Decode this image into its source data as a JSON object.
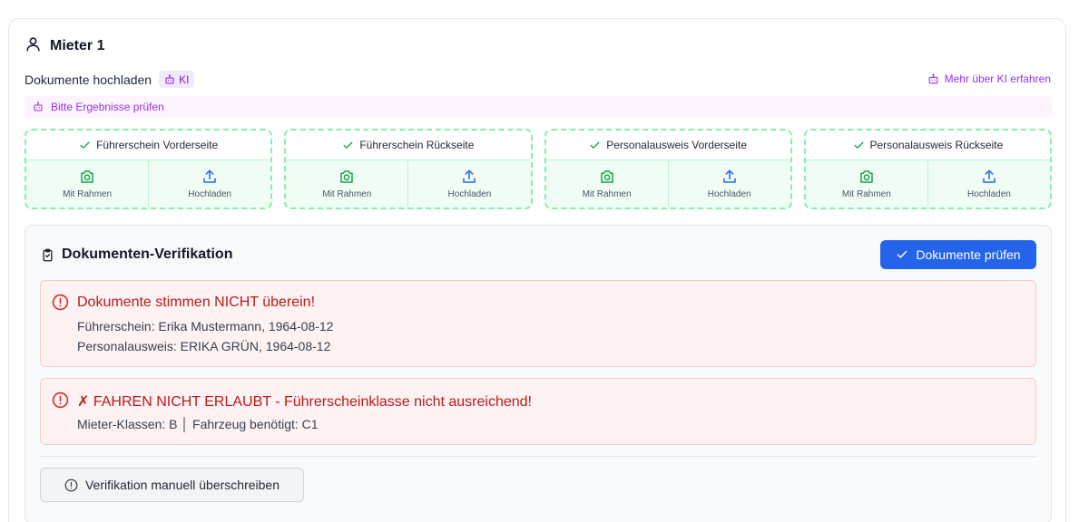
{
  "tenant": {
    "title": "Mieter 1",
    "icon": "user-icon"
  },
  "upload": {
    "label": "Dokumente hochladen",
    "ki_badge": "KI",
    "ki_link": "Mehr über KI erfahren",
    "notice": "Bitte Ergebnisse prüfen"
  },
  "documents": [
    {
      "title": "Führerschein Vorderseite",
      "frame_label": "Mit Rahmen",
      "upload_label": "Hochladen"
    },
    {
      "title": "Führerschein Rückseite",
      "frame_label": "Mit Rahmen",
      "upload_label": "Hochladen"
    },
    {
      "title": "Personalausweis Vorderseite",
      "frame_label": "Mit Rahmen",
      "upload_label": "Hochladen"
    },
    {
      "title": "Personalausweis Rückseite",
      "frame_label": "Mit Rahmen",
      "upload_label": "Hochladen"
    }
  ],
  "verification": {
    "title": "Dokumenten-Verifikation",
    "check_button": "Dokumente prüfen",
    "alerts": [
      {
        "title": "Dokumente stimmen NICHT überein!",
        "lines": [
          "Führerschein: Erika Mustermann, 1964-08-12",
          "Personalausweis: ERIKA GRÜN, 1964-08-12"
        ]
      },
      {
        "title": "✗ FAHREN NICHT ERLAUBT - Führerscheinklasse nicht ausreichend!",
        "lines": [
          "Mieter-Klassen: B │ Fahrzeug benötigt: C1"
        ]
      }
    ],
    "override_button": "Verifikation manuell überschreiben"
  },
  "colors": {
    "primary": "#2563eb",
    "success_border": "#86efac",
    "success_bg": "#f0fdf4",
    "error_bg": "#fef2f2",
    "error_text": "#b91c1c",
    "ki_purple": "#9333ea"
  }
}
